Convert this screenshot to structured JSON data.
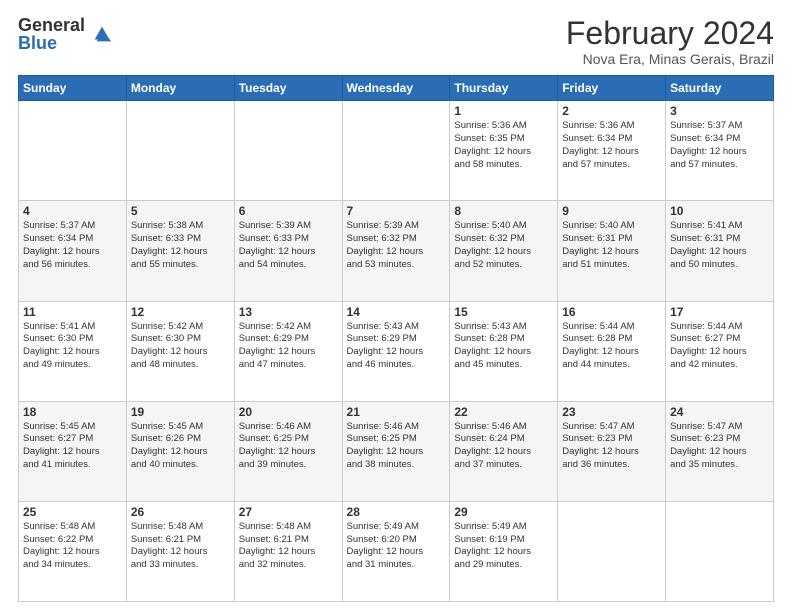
{
  "logo": {
    "general": "General",
    "blue": "Blue"
  },
  "header": {
    "month": "February 2024",
    "location": "Nova Era, Minas Gerais, Brazil"
  },
  "weekdays": [
    "Sunday",
    "Monday",
    "Tuesday",
    "Wednesday",
    "Thursday",
    "Friday",
    "Saturday"
  ],
  "weeks": [
    [
      {
        "day": "",
        "info": ""
      },
      {
        "day": "",
        "info": ""
      },
      {
        "day": "",
        "info": ""
      },
      {
        "day": "",
        "info": ""
      },
      {
        "day": "1",
        "info": "Sunrise: 5:36 AM\nSunset: 6:35 PM\nDaylight: 12 hours\nand 58 minutes."
      },
      {
        "day": "2",
        "info": "Sunrise: 5:36 AM\nSunset: 6:34 PM\nDaylight: 12 hours\nand 57 minutes."
      },
      {
        "day": "3",
        "info": "Sunrise: 5:37 AM\nSunset: 6:34 PM\nDaylight: 12 hours\nand 57 minutes."
      }
    ],
    [
      {
        "day": "4",
        "info": "Sunrise: 5:37 AM\nSunset: 6:34 PM\nDaylight: 12 hours\nand 56 minutes."
      },
      {
        "day": "5",
        "info": "Sunrise: 5:38 AM\nSunset: 6:33 PM\nDaylight: 12 hours\nand 55 minutes."
      },
      {
        "day": "6",
        "info": "Sunrise: 5:39 AM\nSunset: 6:33 PM\nDaylight: 12 hours\nand 54 minutes."
      },
      {
        "day": "7",
        "info": "Sunrise: 5:39 AM\nSunset: 6:32 PM\nDaylight: 12 hours\nand 53 minutes."
      },
      {
        "day": "8",
        "info": "Sunrise: 5:40 AM\nSunset: 6:32 PM\nDaylight: 12 hours\nand 52 minutes."
      },
      {
        "day": "9",
        "info": "Sunrise: 5:40 AM\nSunset: 6:31 PM\nDaylight: 12 hours\nand 51 minutes."
      },
      {
        "day": "10",
        "info": "Sunrise: 5:41 AM\nSunset: 6:31 PM\nDaylight: 12 hours\nand 50 minutes."
      }
    ],
    [
      {
        "day": "11",
        "info": "Sunrise: 5:41 AM\nSunset: 6:30 PM\nDaylight: 12 hours\nand 49 minutes."
      },
      {
        "day": "12",
        "info": "Sunrise: 5:42 AM\nSunset: 6:30 PM\nDaylight: 12 hours\nand 48 minutes."
      },
      {
        "day": "13",
        "info": "Sunrise: 5:42 AM\nSunset: 6:29 PM\nDaylight: 12 hours\nand 47 minutes."
      },
      {
        "day": "14",
        "info": "Sunrise: 5:43 AM\nSunset: 6:29 PM\nDaylight: 12 hours\nand 46 minutes."
      },
      {
        "day": "15",
        "info": "Sunrise: 5:43 AM\nSunset: 6:28 PM\nDaylight: 12 hours\nand 45 minutes."
      },
      {
        "day": "16",
        "info": "Sunrise: 5:44 AM\nSunset: 6:28 PM\nDaylight: 12 hours\nand 44 minutes."
      },
      {
        "day": "17",
        "info": "Sunrise: 5:44 AM\nSunset: 6:27 PM\nDaylight: 12 hours\nand 42 minutes."
      }
    ],
    [
      {
        "day": "18",
        "info": "Sunrise: 5:45 AM\nSunset: 6:27 PM\nDaylight: 12 hours\nand 41 minutes."
      },
      {
        "day": "19",
        "info": "Sunrise: 5:45 AM\nSunset: 6:26 PM\nDaylight: 12 hours\nand 40 minutes."
      },
      {
        "day": "20",
        "info": "Sunrise: 5:46 AM\nSunset: 6:25 PM\nDaylight: 12 hours\nand 39 minutes."
      },
      {
        "day": "21",
        "info": "Sunrise: 5:46 AM\nSunset: 6:25 PM\nDaylight: 12 hours\nand 38 minutes."
      },
      {
        "day": "22",
        "info": "Sunrise: 5:46 AM\nSunset: 6:24 PM\nDaylight: 12 hours\nand 37 minutes."
      },
      {
        "day": "23",
        "info": "Sunrise: 5:47 AM\nSunset: 6:23 PM\nDaylight: 12 hours\nand 36 minutes."
      },
      {
        "day": "24",
        "info": "Sunrise: 5:47 AM\nSunset: 6:23 PM\nDaylight: 12 hours\nand 35 minutes."
      }
    ],
    [
      {
        "day": "25",
        "info": "Sunrise: 5:48 AM\nSunset: 6:22 PM\nDaylight: 12 hours\nand 34 minutes."
      },
      {
        "day": "26",
        "info": "Sunrise: 5:48 AM\nSunset: 6:21 PM\nDaylight: 12 hours\nand 33 minutes."
      },
      {
        "day": "27",
        "info": "Sunrise: 5:48 AM\nSunset: 6:21 PM\nDaylight: 12 hours\nand 32 minutes."
      },
      {
        "day": "28",
        "info": "Sunrise: 5:49 AM\nSunset: 6:20 PM\nDaylight: 12 hours\nand 31 minutes."
      },
      {
        "day": "29",
        "info": "Sunrise: 5:49 AM\nSunset: 6:19 PM\nDaylight: 12 hours\nand 29 minutes."
      },
      {
        "day": "",
        "info": ""
      },
      {
        "day": "",
        "info": ""
      }
    ]
  ]
}
